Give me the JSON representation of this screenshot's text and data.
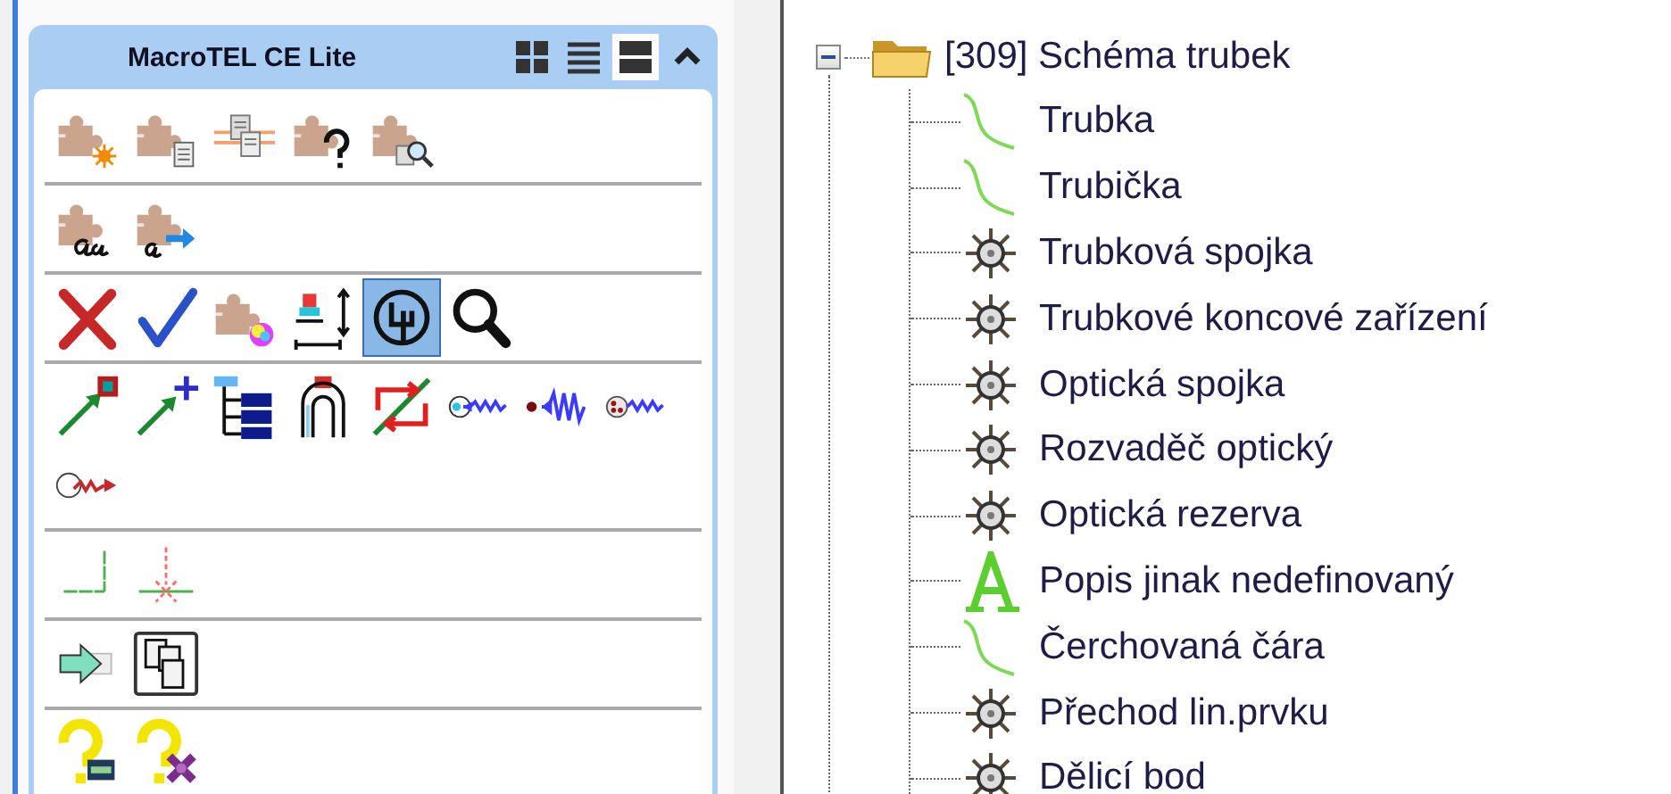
{
  "panel": {
    "title": "MacroTEL CE Lite",
    "view_modes": [
      {
        "selected": false
      },
      {
        "selected": false
      },
      {
        "selected": true
      }
    ],
    "collapsed": false,
    "groups": [
      {
        "buttons": [
          {
            "selected": false
          },
          {
            "selected": false
          },
          {
            "selected": false
          },
          {
            "selected": false
          },
          {
            "selected": false
          }
        ]
      },
      {
        "buttons": [
          {
            "selected": false
          },
          {
            "selected": false
          }
        ]
      },
      {
        "buttons": [
          {
            "selected": false
          },
          {
            "selected": false
          },
          {
            "selected": false
          },
          {
            "selected": false
          },
          {
            "selected": true
          },
          {
            "selected": false
          }
        ]
      },
      {
        "buttons": [
          {
            "selected": false
          },
          {
            "selected": false
          },
          {
            "selected": false
          },
          {
            "selected": false
          },
          {
            "selected": false
          },
          {
            "selected": false
          },
          {
            "selected": false
          },
          {
            "selected": false
          },
          {
            "selected": false
          }
        ]
      },
      {
        "buttons": [
          {
            "selected": false
          },
          {
            "selected": false
          }
        ]
      },
      {
        "buttons": [
          {
            "selected": false
          },
          {
            "selected": false
          }
        ]
      },
      {
        "buttons": [
          {
            "selected": false
          },
          {
            "selected": false
          }
        ]
      }
    ]
  },
  "tree": {
    "label": "[309] Schéma trubek",
    "expanded": true,
    "children": [
      {
        "label": "Trubka",
        "kind": "line"
      },
      {
        "label": "Trubička",
        "kind": "line"
      },
      {
        "label": "Trubková spojka",
        "kind": "node"
      },
      {
        "label": "Trubkové koncové zařízení",
        "kind": "node"
      },
      {
        "label": "Optická spojka",
        "kind": "node"
      },
      {
        "label": "Rozvaděč optický",
        "kind": "node"
      },
      {
        "label": "Optická rezerva",
        "kind": "node"
      },
      {
        "label": "Popis jinak nedefinovaný",
        "kind": "text"
      },
      {
        "label": "Čerchovaná čára",
        "kind": "line"
      },
      {
        "label": "Přechod lin.prvku",
        "kind": "node"
      },
      {
        "label": "Dělicí bod",
        "kind": "node"
      }
    ]
  }
}
